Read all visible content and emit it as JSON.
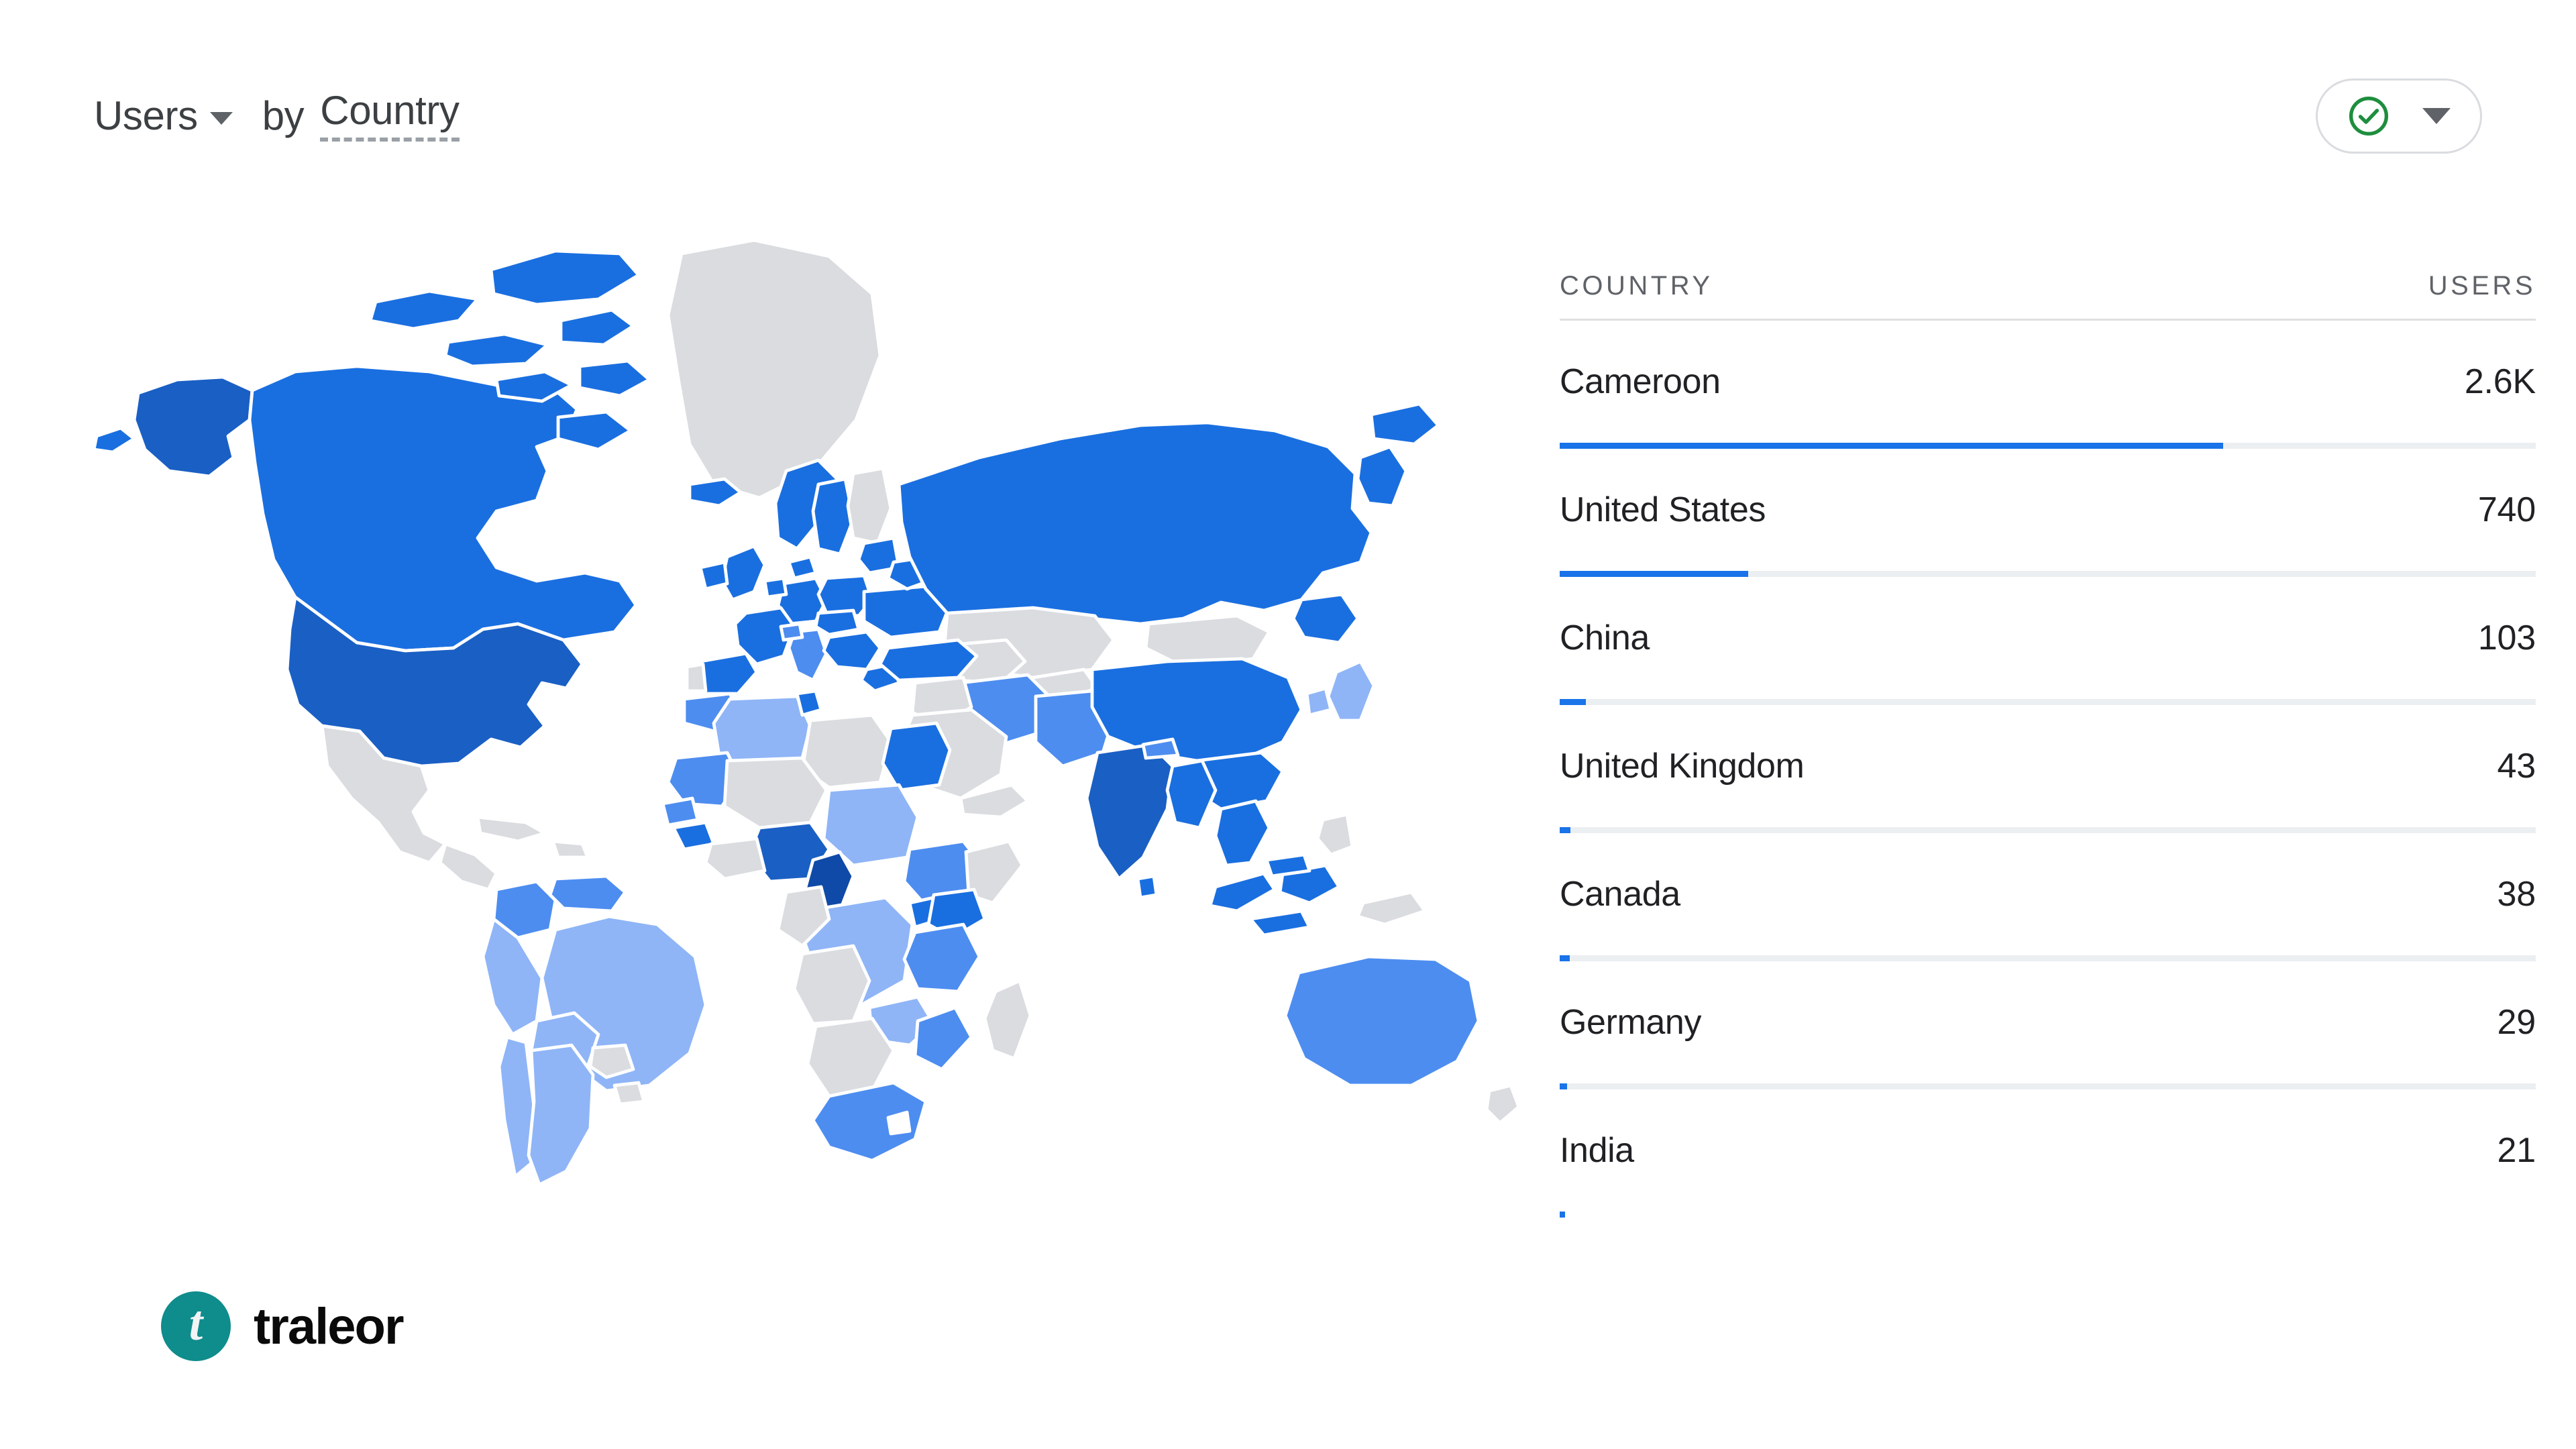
{
  "header": {
    "metric_label": "Users",
    "metric_caret_icon": "chevron-down-icon",
    "by_word": "by",
    "dimension_label": "Country",
    "status_icon": "check-circle-icon",
    "status_caret_icon": "chevron-down-icon"
  },
  "table": {
    "columns": [
      "COUNTRY",
      "USERS"
    ],
    "rows": [
      {
        "country": "Cameroon",
        "users": "2.6K",
        "value": 2600,
        "bar_pct": 68.0
      },
      {
        "country": "United States",
        "users": "740",
        "value": 740,
        "bar_pct": 19.3
      },
      {
        "country": "China",
        "users": "103",
        "value": 103,
        "bar_pct": 2.7
      },
      {
        "country": "United Kingdom",
        "users": "43",
        "value": 43,
        "bar_pct": 1.1
      },
      {
        "country": "Canada",
        "users": "38",
        "value": 38,
        "bar_pct": 1.0
      },
      {
        "country": "Germany",
        "users": "29",
        "value": 29,
        "bar_pct": 0.75
      },
      {
        "country": "India",
        "users": "21",
        "value": 21,
        "bar_pct": 0.55
      }
    ]
  },
  "logo": {
    "mark_letter": "t",
    "wordmark": "traleor",
    "mark_color": "#0f8c8c"
  },
  "colors": {
    "accent_blue": "#1a73e8",
    "bar_track": "#eceff1",
    "map_level_5": "#0f4aa8",
    "map_level_4": "#1a5fc4",
    "map_level_3": "#1a6fe0",
    "map_level_2": "#4d8df0",
    "map_level_1": "#8fb5f7",
    "map_no_data": "#dadce0",
    "text_primary": "#202124",
    "text_secondary": "#5f6368",
    "status_green": "#1e8e3e"
  },
  "chart_data": {
    "type": "bar",
    "title": "Users by Country",
    "xlabel": "",
    "ylabel": "Users",
    "categories": [
      "Cameroon",
      "United States",
      "China",
      "United Kingdom",
      "Canada",
      "Germany",
      "India"
    ],
    "values": [
      2600,
      740,
      103,
      43,
      38,
      29,
      21
    ],
    "value_labels": [
      "2.6K",
      "740",
      "103",
      "43",
      "38",
      "29",
      "21"
    ],
    "ylim": [
      0,
      3822
    ],
    "grid": false,
    "legend": "none",
    "companion_map": {
      "type": "choropleth",
      "scale": "sequential-blue",
      "no_data_color": "#dadce0",
      "highlighted": {
        "Cameroon": "level_5",
        "United States": "level_4",
        "India": "level_4",
        "China": "level_3",
        "Russia": "level_3",
        "Canada": "level_3",
        "Australia": "level_2",
        "Argentina": "level_1",
        "Algeria": "level_1"
      }
    }
  }
}
